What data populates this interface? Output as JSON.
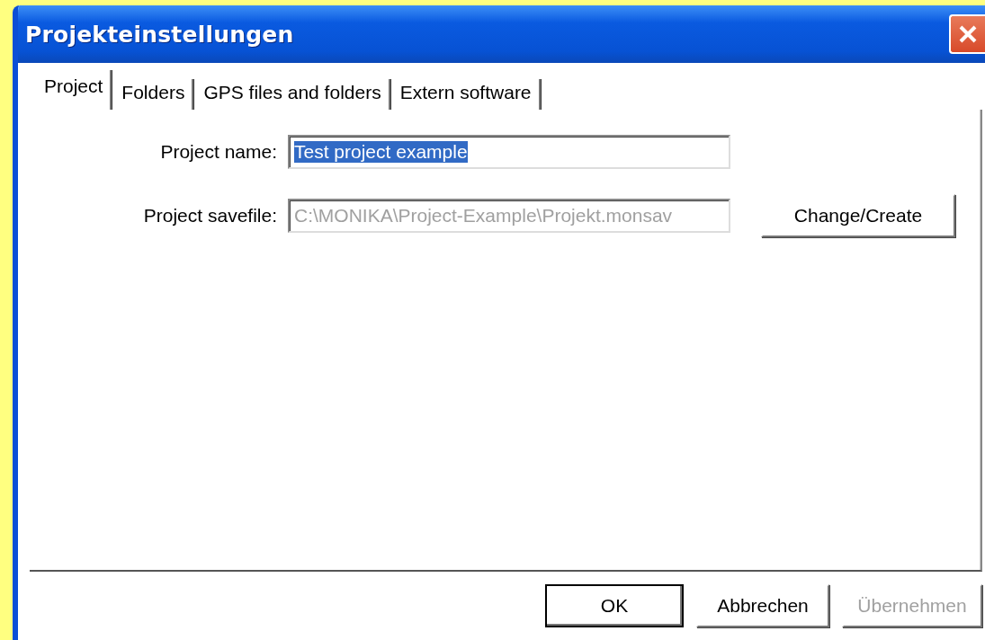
{
  "window": {
    "title": "Projekteinstellungen"
  },
  "tabs": [
    {
      "label": "Project",
      "selected": true
    },
    {
      "label": "Folders",
      "selected": false
    },
    {
      "label": "GPS files and folders",
      "selected": false
    },
    {
      "label": "Extern software",
      "selected": false
    }
  ],
  "fields": [
    {
      "label": "Project name:",
      "value": "Test project example",
      "text_selected": true,
      "disabled": false
    },
    {
      "label": "Project savefile:",
      "value": "C:\\MONIKA\\Project-Example\\Projekt.monsav",
      "text_selected": false,
      "disabled": true,
      "button": "Change/Create"
    }
  ],
  "buttons": [
    {
      "label": "OK",
      "default": true,
      "disabled": false
    },
    {
      "label": "Abbrechen",
      "default": false,
      "disabled": false
    },
    {
      "label": "Übernehmen",
      "default": false,
      "disabled": true
    }
  ]
}
